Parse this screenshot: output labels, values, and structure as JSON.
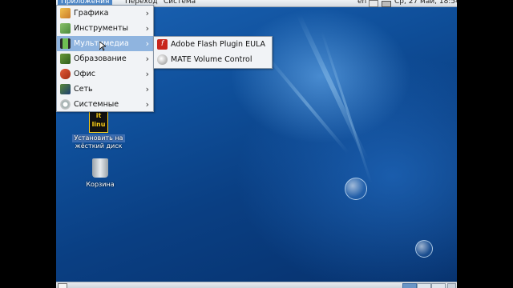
{
  "top_panel": {
    "applications_label": "Приложения",
    "places_label": "Переход",
    "system_label": "Система",
    "keyboard_layout": "en",
    "clock": "Ср, 27 май, 18:54"
  },
  "menu": {
    "items": [
      {
        "label": "Графика",
        "icon": "graphics-icon"
      },
      {
        "label": "Инструменты",
        "icon": "tools-icon"
      },
      {
        "label": "Мультимедиа",
        "icon": "multimedia-icon"
      },
      {
        "label": "Образование",
        "icon": "education-icon"
      },
      {
        "label": "Офис",
        "icon": "office-icon"
      },
      {
        "label": "Сеть",
        "icon": "network-icon"
      },
      {
        "label": "Системные",
        "icon": "system-icon"
      }
    ],
    "active_index": 2
  },
  "submenu": {
    "items": [
      {
        "label": "Adobe Flash Plugin EULA",
        "icon": "flash-icon"
      },
      {
        "label": "MATE Volume Control",
        "icon": "volume-icon"
      }
    ]
  },
  "desktop": {
    "installer": {
      "line1": "Установить на",
      "line2": "жёсткий диск",
      "logo": "it linux"
    },
    "trash": {
      "label": "Корзина"
    }
  },
  "colors": {
    "highlight": "#8fb4df",
    "panel_active": "#4d86c6"
  }
}
